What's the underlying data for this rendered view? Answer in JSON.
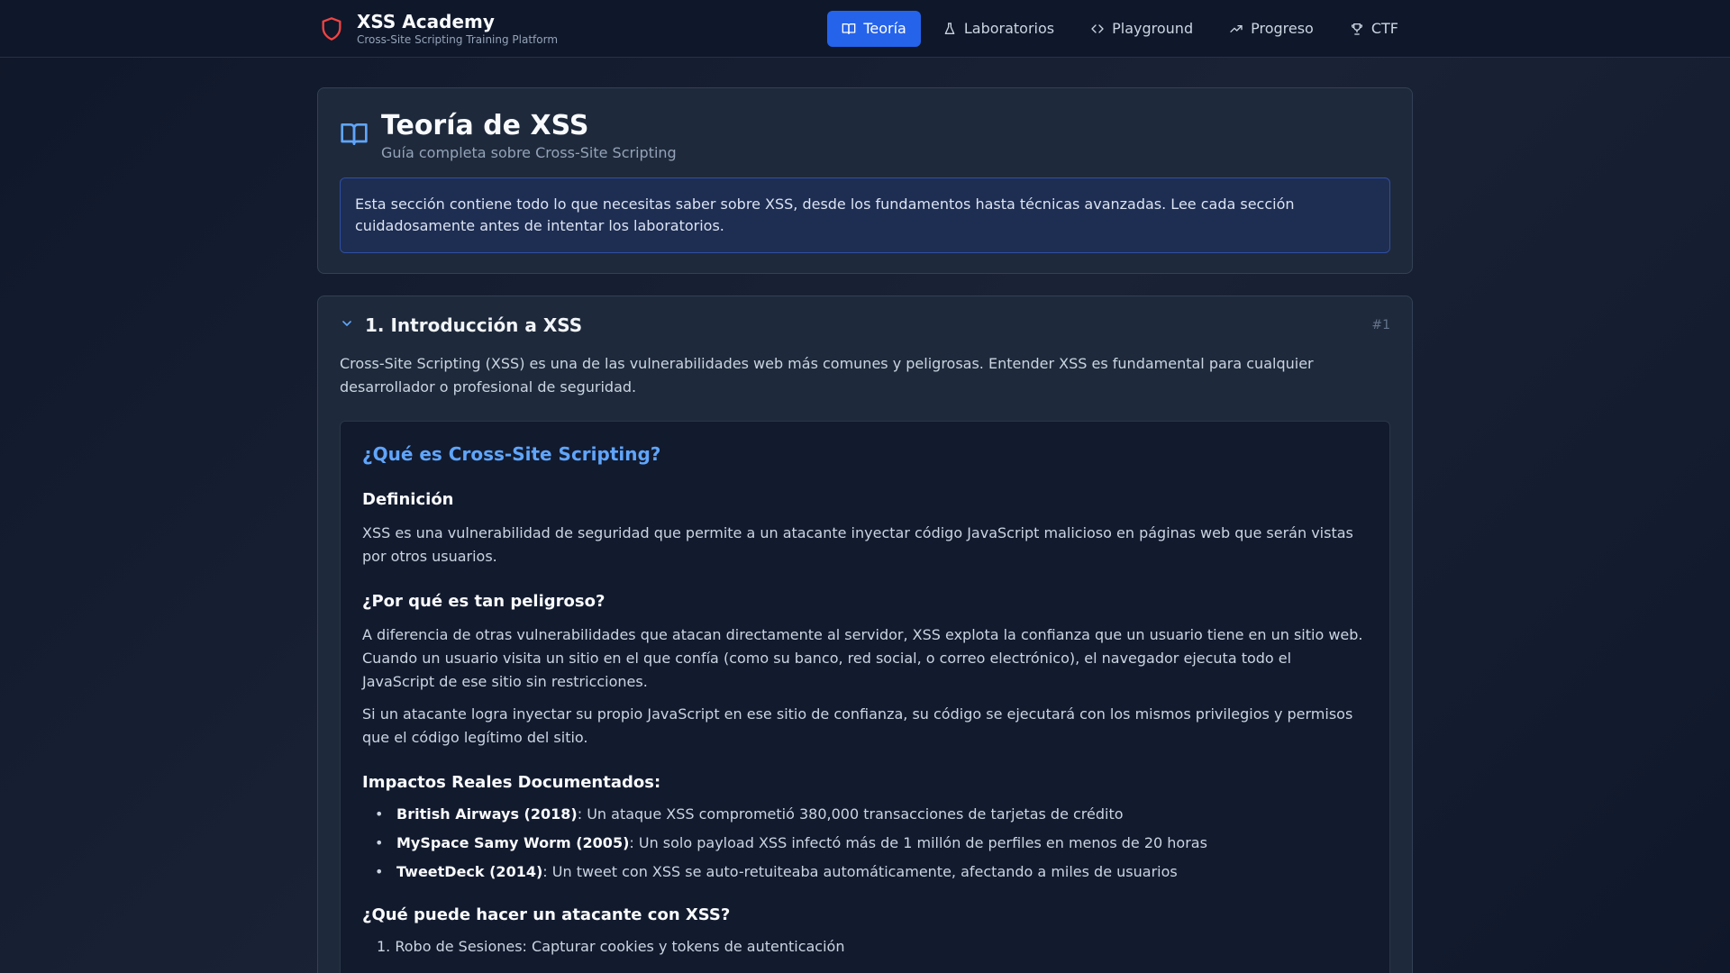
{
  "header": {
    "brand_title": "XSS Academy",
    "brand_subtitle": "Cross-Site Scripting Training Platform",
    "nav": [
      {
        "label": "Teoría",
        "icon": "book-icon",
        "active": true
      },
      {
        "label": "Laboratorios",
        "icon": "flask-icon",
        "active": false
      },
      {
        "label": "Playground",
        "icon": "code-icon",
        "active": false
      },
      {
        "label": "Progreso",
        "icon": "trending-up-icon",
        "active": false
      },
      {
        "label": "CTF",
        "icon": "trophy-icon",
        "active": false
      }
    ]
  },
  "hero": {
    "title": "Teoría de XSS",
    "subtitle": "Guía completa sobre Cross-Site Scripting",
    "notice": "Esta sección contiene todo lo que necesitas saber sobre XSS, desde los fundamentos hasta técnicas avanzadas. Lee cada sección cuidadosamente antes de intentar los laboratorios."
  },
  "section": {
    "title": "1. Introducción a XSS",
    "number": "#1",
    "intro": "Cross-Site Scripting (XSS) es una de las vulnerabilidades web más comunes y peligrosas. Entender XSS es fundamental para cualquier desarrollador o profesional de seguridad.",
    "content": {
      "heading": "¿Qué es Cross-Site Scripting?",
      "definition_title": "Definición",
      "definition_text": "XSS es una vulnerabilidad de seguridad que permite a un atacante inyectar código JavaScript malicioso en páginas web que serán vistas por otros usuarios.",
      "danger_title": "¿Por qué es tan peligroso?",
      "danger_p1": "A diferencia de otras vulnerabilidades que atacan directamente al servidor, XSS explota la confianza que un usuario tiene en un sitio web. Cuando un usuario visita un sitio en el que confía (como su banco, red social, o correo electrónico), el navegador ejecuta todo el JavaScript de ese sitio sin restricciones.",
      "danger_p2": "Si un atacante logra inyectar su propio JavaScript en ese sitio de confianza, su código se ejecutará con los mismos privilegios y permisos que el código legítimo del sitio.",
      "impacts_title": "Impactos Reales Documentados:",
      "impacts": [
        {
          "bold": "British Airways (2018)",
          "text": ": Un ataque XSS comprometió 380,000 transacciones de tarjetas de crédito"
        },
        {
          "bold": "MySpace Samy Worm (2005)",
          "text": ": Un solo payload XSS infectó más de 1 millón de perfiles en menos de 20 horas"
        },
        {
          "bold": "TweetDeck (2014)",
          "text": ": Un tweet con XSS se auto-retuiteaba automáticamente, afectando a miles de usuarios"
        }
      ],
      "attacker_title": "¿Qué puede hacer un atacante con XSS?",
      "attacker_items": [
        "1. Robo de Sesiones: Capturar cookies y tokens de autenticación"
      ]
    }
  }
}
